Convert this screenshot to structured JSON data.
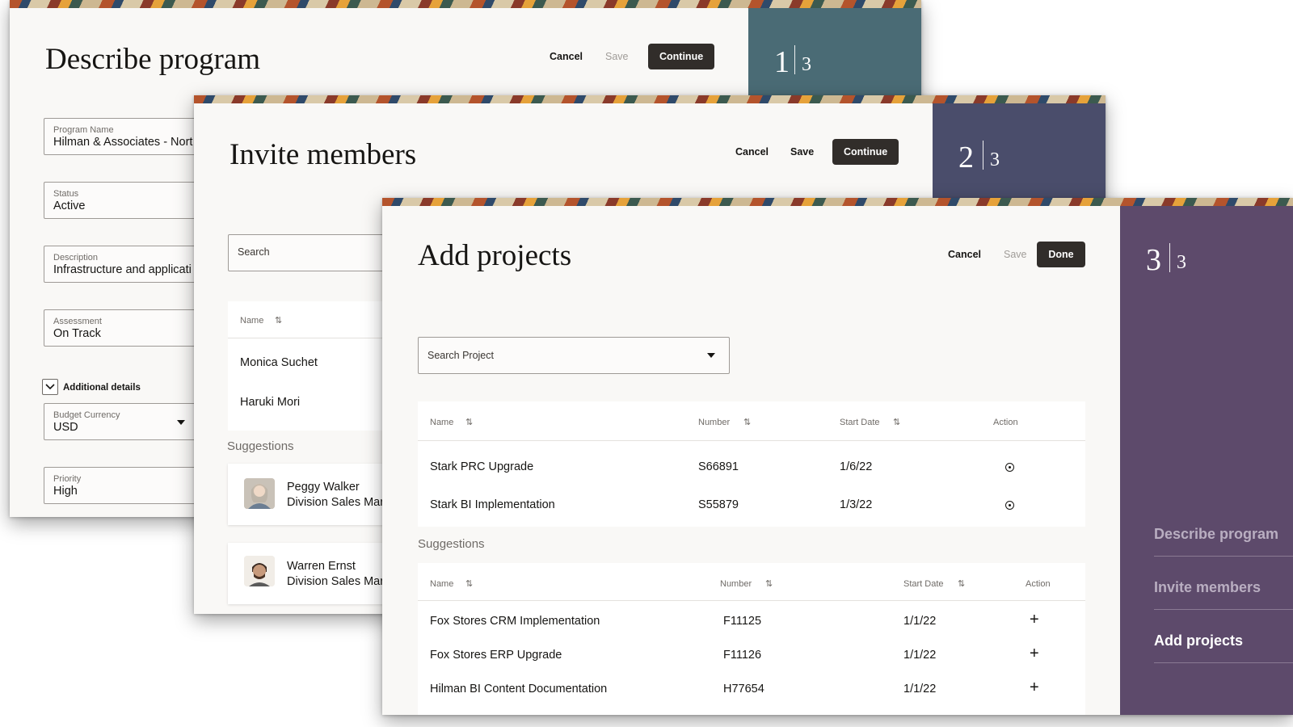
{
  "colors": {
    "step1": "#4a6b75",
    "step2": "#4a4d6b",
    "step3": "#5d4a6b",
    "primary": "#312d2a"
  },
  "panel1": {
    "title": "Describe program",
    "cancel": "Cancel",
    "save": "Save",
    "continue": "Continue",
    "step_current": "1",
    "step_total": "3",
    "fields": {
      "program_name": {
        "label": "Program Name",
        "value": "Hilman & Associates - Nort"
      },
      "status": {
        "label": "Status",
        "value": "Active"
      },
      "description": {
        "label": "Description",
        "value": "Infrastructure and applicati"
      },
      "assessment": {
        "label": "Assessment",
        "value": "On Track"
      },
      "additional_details": "Additional details",
      "budget_currency": {
        "label": "Budget Currency",
        "value": "USD"
      },
      "priority": {
        "label": "Priority",
        "value": "High"
      }
    }
  },
  "panel2": {
    "title": "Invite members",
    "cancel": "Cancel",
    "save": "Save",
    "continue": "Continue",
    "step_current": "2",
    "step_total": "3",
    "search_placeholder": "Search",
    "name_header": "Name",
    "members": [
      "Monica Suchet",
      "Haruki Mori"
    ],
    "suggestions_label": "Suggestions",
    "suggestions": [
      {
        "name": "Peggy Walker",
        "role": "Division Sales Mar"
      },
      {
        "name": "Warren Ernst",
        "role": "Division Sales Mar"
      }
    ]
  },
  "panel3": {
    "title": "Add projects",
    "cancel": "Cancel",
    "save": "Save",
    "done": "Done",
    "step_current": "3",
    "step_total": "3",
    "search_placeholder": "Search Project",
    "headers": {
      "name": "Name",
      "number": "Number",
      "start_date": "Start Date",
      "action": "Action"
    },
    "projects": [
      {
        "name": "Stark PRC Upgrade",
        "number": "S66891",
        "start_date": "1/6/22"
      },
      {
        "name": "Stark BI Implementation",
        "number": "S55879",
        "start_date": "1/3/22"
      }
    ],
    "suggestions_label": "Suggestions",
    "suggestions": [
      {
        "name": "Fox Stores CRM Implementation",
        "number": "F11125",
        "start_date": "1/1/22",
        "action": "+"
      },
      {
        "name": "Fox Stores ERP Upgrade",
        "number": "F11126",
        "start_date": "1/1/22",
        "action": "+"
      },
      {
        "name": "Hilman BI Content Documentation",
        "number": "H77654",
        "start_date": "1/1/22",
        "action": "+"
      }
    ],
    "nav": [
      "Describe program",
      "Invite members",
      "Add projects"
    ]
  },
  "sort_glyph": "⇅"
}
